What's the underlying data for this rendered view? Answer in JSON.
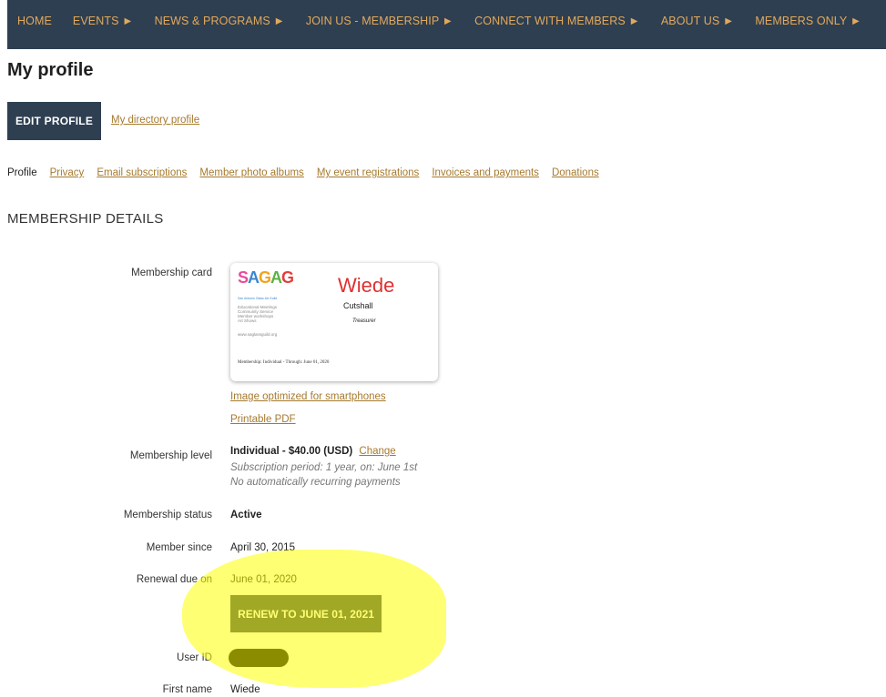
{
  "nav": {
    "items": [
      "HOME",
      "EVENTS ►",
      "NEWS & PROGRAMS ►",
      "JOIN US - MEMBERSHIP ►",
      "CONNECT WITH MEMBERS ►",
      "ABOUT US ►",
      "MEMBERS ONLY ►"
    ]
  },
  "page": {
    "title": "My profile",
    "edit_button": "EDIT PROFILE",
    "directory_link": "My directory profile"
  },
  "subnav": {
    "current": "Profile",
    "links": [
      "Privacy",
      "Email subscriptions",
      "Member photo albums",
      "My event registrations",
      "Invoices and payments",
      "Donations"
    ]
  },
  "section_title": "MEMBERSHIP DETAILS",
  "card": {
    "label": "Membership card",
    "logo": [
      "S",
      "A",
      "G",
      "A",
      "G"
    ],
    "guild": "San Antonio Glass Art Guild",
    "tagline": "Educational Meetings\nCommunity Service\nMember workshops\nArt Shows",
    "site": "www.saglassguild.org",
    "first_name": "Wiede",
    "last_name": "Cutshall",
    "role": "Treasurer",
    "footer": "Membership: Individual - Through: June 01, 2020",
    "smartphone_link": "Image optimized for smartphones",
    "pdf_link": "Printable PDF"
  },
  "membership": {
    "level_label": "Membership level",
    "level_value": "Individual - $40.00 (USD)",
    "change_link": "Change",
    "period": "Subscription period: 1 year, on: June 1st",
    "recurring": "No automatically recurring payments",
    "status_label": "Membership status",
    "status_value": "Active",
    "since_label": "Member since",
    "since_value": "April 30, 2015",
    "renewal_label": "Renewal due on",
    "renewal_value": "June 01, 2020",
    "renew_button": "RENEW TO JUNE 01, 2021",
    "userid_label": "User ID",
    "firstname_label": "First name",
    "firstname_value": "Wiede"
  },
  "colors": {
    "nav_bg": "#2e3f52",
    "nav_text": "#e2a95a",
    "link": "#a67a2e",
    "highlight": "#ffff00"
  }
}
